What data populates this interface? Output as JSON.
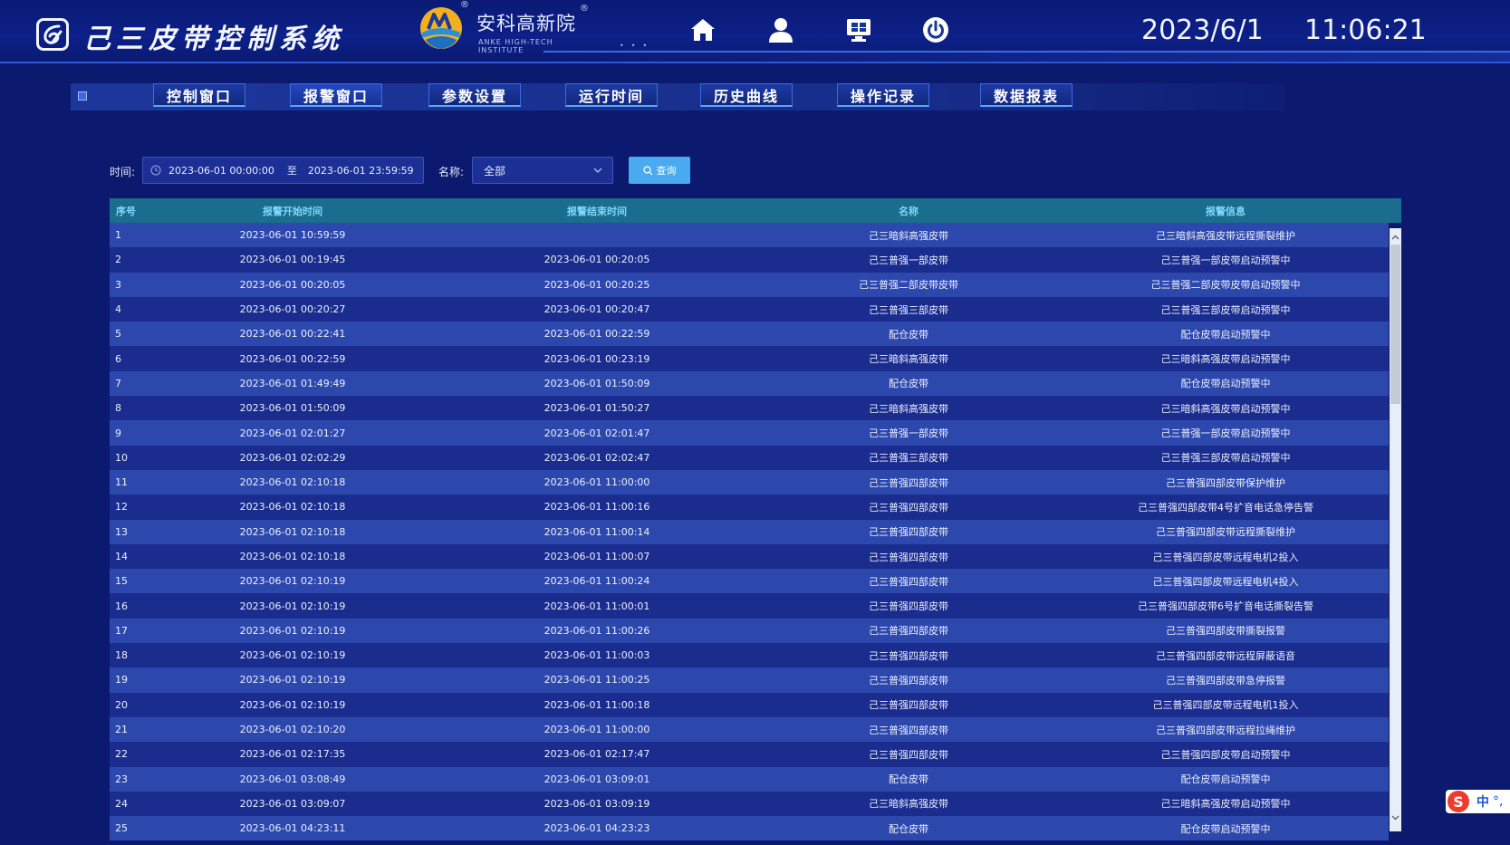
{
  "header": {
    "system_title": "己三皮带控制系统",
    "brand_name": "安科高新院",
    "brand_sub": "ANKE HIGH-TECH INSTITUTE",
    "registered_mark": "®",
    "date": "2023/6/1",
    "time": "11:06:21",
    "icons": [
      "home-icon",
      "user-icon",
      "monitor-icon",
      "power-icon"
    ]
  },
  "tabs": [
    {
      "label": "控制窗口",
      "active": false
    },
    {
      "label": "报警窗口",
      "active": true
    },
    {
      "label": "参数设置",
      "active": false
    },
    {
      "label": "运行时间",
      "active": false
    },
    {
      "label": "历史曲线",
      "active": false
    },
    {
      "label": "操作记录",
      "active": false
    },
    {
      "label": "数据报表",
      "active": false
    }
  ],
  "filter": {
    "time_label": "时间:",
    "start": "2023-06-01 00:00:00",
    "to": "至",
    "end": "2023-06-01 23:59:59",
    "name_label": "名称:",
    "name_value": "全部",
    "query_label": "查询"
  },
  "table": {
    "headers": [
      "序号",
      "报警开始时间",
      "报警结束时间",
      "名称",
      "报警信息"
    ],
    "rows": [
      [
        "1",
        "2023-06-01 10:59:59",
        "",
        "己三暗斜高强皮带",
        "己三暗斜高强皮带远程撕裂维护"
      ],
      [
        "2",
        "2023-06-01 00:19:45",
        "2023-06-01 00:20:05",
        "己三普强一部皮带",
        "己三普强一部皮带启动预警中"
      ],
      [
        "3",
        "2023-06-01 00:20:05",
        "2023-06-01 00:20:25",
        "己三普强二部皮带皮带",
        "己三普强二部皮带皮带启动预警中"
      ],
      [
        "4",
        "2023-06-01 00:20:27",
        "2023-06-01 00:20:47",
        "己三普强三部皮带",
        "己三普强三部皮带启动预警中"
      ],
      [
        "5",
        "2023-06-01 00:22:41",
        "2023-06-01 00:22:59",
        "配仓皮带",
        "配仓皮带启动预警中"
      ],
      [
        "6",
        "2023-06-01 00:22:59",
        "2023-06-01 00:23:19",
        "己三暗斜高强皮带",
        "己三暗斜高强皮带启动预警中"
      ],
      [
        "7",
        "2023-06-01 01:49:49",
        "2023-06-01 01:50:09",
        "配仓皮带",
        "配仓皮带启动预警中"
      ],
      [
        "8",
        "2023-06-01 01:50:09",
        "2023-06-01 01:50:27",
        "己三暗斜高强皮带",
        "己三暗斜高强皮带启动预警中"
      ],
      [
        "9",
        "2023-06-01 02:01:27",
        "2023-06-01 02:01:47",
        "己三普强一部皮带",
        "己三普强一部皮带启动预警中"
      ],
      [
        "10",
        "2023-06-01 02:02:29",
        "2023-06-01 02:02:47",
        "己三普强三部皮带",
        "己三普强三部皮带启动预警中"
      ],
      [
        "11",
        "2023-06-01 02:10:18",
        "2023-06-01 11:00:00",
        "己三普强四部皮带",
        "己三普强四部皮带保护维护"
      ],
      [
        "12",
        "2023-06-01 02:10:18",
        "2023-06-01 11:00:16",
        "己三普强四部皮带",
        "己三普强四部皮带4号扩音电话急停告警"
      ],
      [
        "13",
        "2023-06-01 02:10:18",
        "2023-06-01 11:00:14",
        "己三普强四部皮带",
        "己三普强四部皮带远程撕裂维护"
      ],
      [
        "14",
        "2023-06-01 02:10:18",
        "2023-06-01 11:00:07",
        "己三普强四部皮带",
        "己三普强四部皮带远程电机2投入"
      ],
      [
        "15",
        "2023-06-01 02:10:19",
        "2023-06-01 11:00:24",
        "己三普强四部皮带",
        "己三普强四部皮带远程电机4投入"
      ],
      [
        "16",
        "2023-06-01 02:10:19",
        "2023-06-01 11:00:01",
        "己三普强四部皮带",
        "己三普强四部皮带6号扩音电话撕裂告警"
      ],
      [
        "17",
        "2023-06-01 02:10:19",
        "2023-06-01 11:00:26",
        "己三普强四部皮带",
        "己三普强四部皮带撕裂报警"
      ],
      [
        "18",
        "2023-06-01 02:10:19",
        "2023-06-01 11:00:03",
        "己三普强四部皮带",
        "己三普强四部皮带远程屏蔽语音"
      ],
      [
        "19",
        "2023-06-01 02:10:19",
        "2023-06-01 11:00:25",
        "己三普强四部皮带",
        "己三普强四部皮带急停报警"
      ],
      [
        "20",
        "2023-06-01 02:10:19",
        "2023-06-01 11:00:18",
        "己三普强四部皮带",
        "己三普强四部皮带远程电机1投入"
      ],
      [
        "21",
        "2023-06-01 02:10:20",
        "2023-06-01 11:00:00",
        "己三普强四部皮带",
        "己三普强四部皮带远程拉绳维护"
      ],
      [
        "22",
        "2023-06-01 02:17:35",
        "2023-06-01 02:17:47",
        "己三普强四部皮带",
        "己三普强四部皮带启动预警中"
      ],
      [
        "23",
        "2023-06-01 03:08:49",
        "2023-06-01 03:09:01",
        "配仓皮带",
        "配仓皮带启动预警中"
      ],
      [
        "24",
        "2023-06-01 03:09:07",
        "2023-06-01 03:09:19",
        "己三暗斜高强皮带",
        "己三暗斜高强皮带启动预警中"
      ],
      [
        "25",
        "2023-06-01 04:23:11",
        "2023-06-01 04:23:23",
        "配仓皮带",
        "配仓皮带启动预警中"
      ]
    ]
  },
  "ime": {
    "logo": "S",
    "lang": "中",
    "punct": "°,"
  },
  "colors": {
    "background": "#0b1a6e",
    "header_bar": "#1a6d8c",
    "row_odd": "#2d48ad",
    "row_even": "#1a2c8d",
    "query_button": "#4aaaf0",
    "header_text": "#7fd8ff"
  }
}
